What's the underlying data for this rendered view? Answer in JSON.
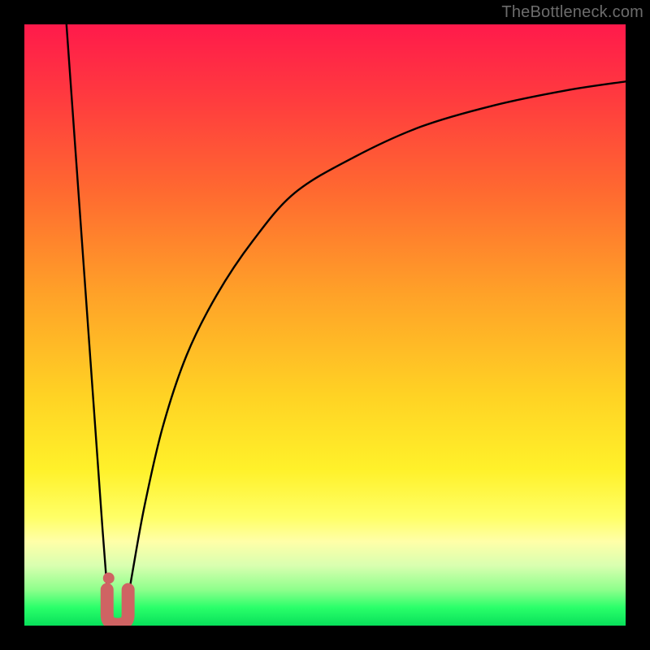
{
  "watermark": "TheBottleneck.com",
  "chart_axes": {
    "x_range": [
      0,
      100
    ],
    "y_range_percent_bottleneck": [
      0,
      100
    ],
    "note": "axes are unlabeled in the image; values below are estimated from curve geometry"
  },
  "chart_data": {
    "type": "line",
    "title": "",
    "xlabel": "",
    "ylabel": "",
    "xlim": [
      0,
      100
    ],
    "ylim": [
      0,
      100
    ],
    "series": [
      {
        "name": "left-descent",
        "x": [
          7,
          8,
          9,
          10,
          11,
          12,
          13,
          14
        ],
        "y": [
          100,
          86,
          72,
          58,
          44,
          30,
          16,
          3
        ]
      },
      {
        "name": "right-ascent",
        "x": [
          17,
          18,
          20,
          23,
          27,
          32,
          38,
          45,
          55,
          66,
          78,
          90,
          100
        ],
        "y": [
          3,
          9,
          20,
          33,
          45,
          55,
          64,
          72,
          78,
          83,
          86.5,
          89,
          90.5
        ]
      }
    ],
    "marker": {
      "name": "U-shaped-highlight",
      "color": "#cf6363",
      "approx_center_x": 15.5,
      "approx_bottom_y": 1,
      "approx_top_y": 6,
      "width_x": 3.5
    },
    "background_gradient_meaning": "top (red) = high bottleneck, bottom (green) = low/no bottleneck"
  }
}
